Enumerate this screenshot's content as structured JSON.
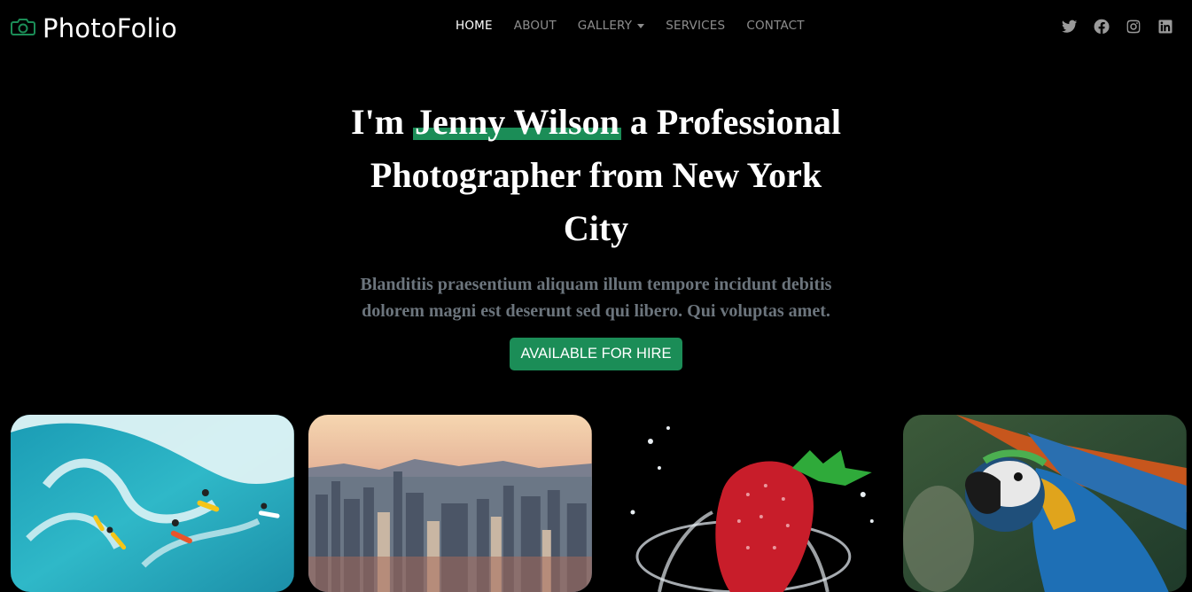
{
  "brand": {
    "name": "PhotoFolio",
    "icon": "camera-icon",
    "icon_color": "#1b8d57"
  },
  "nav": {
    "items": [
      {
        "label": "HOME",
        "active": true
      },
      {
        "label": "ABOUT",
        "active": false
      },
      {
        "label": "GALLERY",
        "active": false,
        "dropdown": true
      },
      {
        "label": "SERVICES",
        "active": false
      },
      {
        "label": "CONTACT",
        "active": false
      }
    ]
  },
  "social": [
    "twitter-icon",
    "facebook-icon",
    "instagram-icon",
    "linkedin-icon"
  ],
  "hero": {
    "title_prefix": "I'm ",
    "title_highlight": "Jenny Wilson",
    "title_suffix": " a Professional Photographer from New York City",
    "subtitle": "Blanditiis praesentium aliquam illum tempore incidunt debitis dolorem magni est deserunt sed qui libero. Qui voluptas amet.",
    "button_label": "AVAILABLE FOR HIRE"
  },
  "gallery": [
    "surfers-photo",
    "city-skyline-photo",
    "strawberry-splash-photo",
    "parrot-photo"
  ],
  "colors": {
    "accent": "#1b8d57",
    "background": "#000000",
    "muted_text": "#6c757d"
  }
}
